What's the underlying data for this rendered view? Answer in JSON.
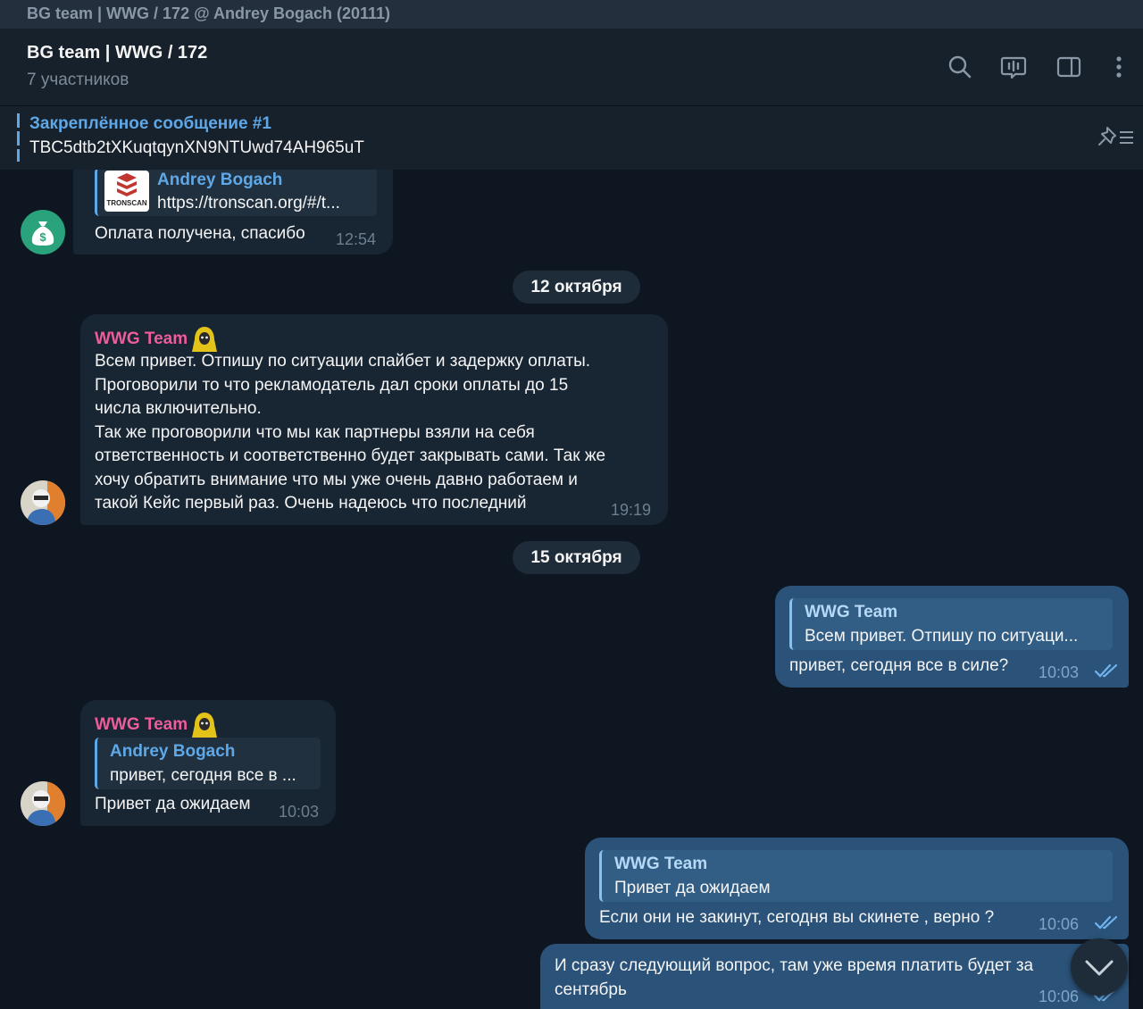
{
  "window": {
    "title": "BG team | WWG / 172 @ Andrey Bogach (20111)"
  },
  "header": {
    "chat_title": "BG team | WWG / 172",
    "members": "7 участников"
  },
  "pinned": {
    "title": "Закреплённое сообщение #1",
    "text": "TBC5dtb2tXKuqtqynXN9NTUwd74AH965uT"
  },
  "messages": {
    "m1": {
      "reply_name": "Andrey Bogach",
      "reply_text": "https://tronscan.org/#/t...",
      "reply_thumb_label": "TRONSCAN",
      "text": "Оплата получена, спасибо",
      "time": "12:54"
    },
    "date1": "12 октября",
    "m2": {
      "sender": "WWG Team",
      "lines": [
        "Всем привет. Отпишу по ситуации спайбет и задержку оплаты.",
        "Проговорили то что рекламодатель дал сроки оплаты до 15",
        "числа включительно.",
        "Так же проговорили что мы как партнеры взяли на себя",
        "ответственность и соответственно будет закрывать сами.  Так же",
        "хочу обратить внимание что мы уже очень давно работаем и",
        "такой Кейс первый раз. Очень надеюсь что последний"
      ],
      "time": "19:19"
    },
    "date2": "15 октября",
    "m3": {
      "reply_name": "WWG Team",
      "reply_text": "Всем привет. Отпишу по ситуаци...",
      "text": "привет, сегодня все в силе?",
      "time": "10:03"
    },
    "m4": {
      "sender": "WWG Team",
      "reply_name": "Andrey Bogach",
      "reply_text": "привет, сегодня все в ...",
      "text": "Привет да ожидаем",
      "time": "10:03"
    },
    "m5": {
      "reply_name": "WWG Team",
      "reply_text": "Привет да ожидаем",
      "text": "Если они не закинут, сегодня вы скинете , верно ?",
      "time": "10:06"
    },
    "m6": {
      "lines": [
        "И сразу следующий вопрос, там уже время платить будет за",
        "сентябрь"
      ],
      "time": "10:06"
    }
  },
  "icons": {
    "search": "search-icon",
    "live": "live-stream-icon",
    "sidebar": "sidebar-toggle-icon",
    "menu": "more-vertical-icon",
    "pin_list": "pin-list-icon",
    "scroll": "chevron-down-icon"
  },
  "colors": {
    "background": "#0e1621",
    "incoming_bubble": "#182533",
    "outgoing_bubble": "#2b5278",
    "accent": "#5fa8e8",
    "sender_name": "#ee5c9a"
  }
}
